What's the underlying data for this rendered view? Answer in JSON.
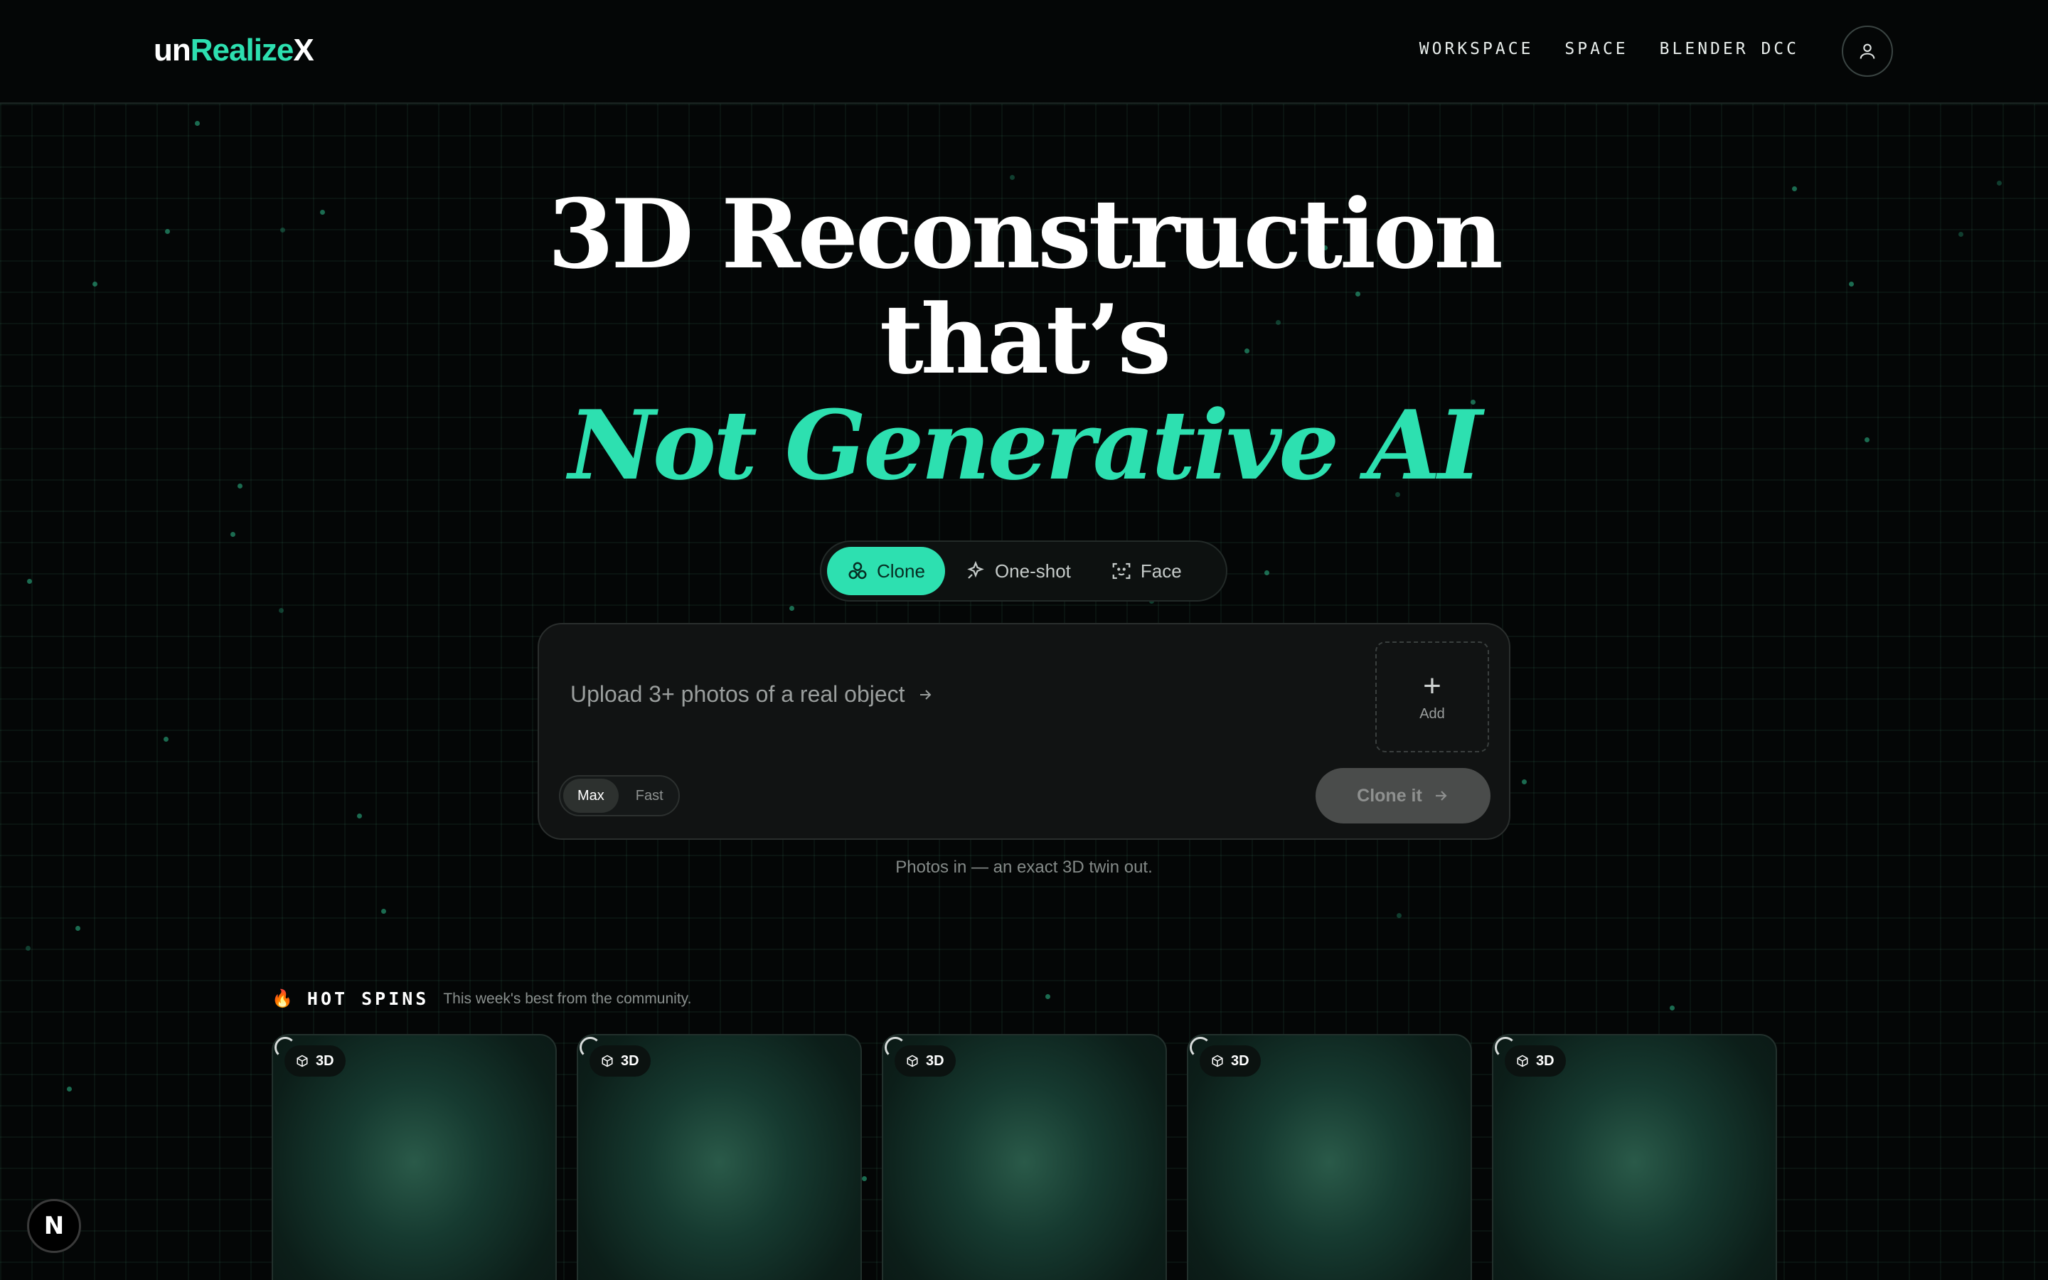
{
  "brand": {
    "part1": "un",
    "part2": "Realize",
    "part3": "X"
  },
  "nav": {
    "workspace": "WORKSPACE",
    "space": "SPACE",
    "blender": "BLENDER DCC"
  },
  "hero": {
    "line1": "3D Reconstruction",
    "line2": "that’s",
    "line3": "Not Generative AI"
  },
  "modes": [
    {
      "label": "Clone",
      "icon": "clone-icon",
      "active": true
    },
    {
      "label": "One-shot",
      "icon": "sparkle-icon",
      "active": false
    },
    {
      "label": "Face",
      "icon": "face-scan-icon",
      "active": false
    }
  ],
  "upload": {
    "prompt": "Upload 3+ photos of a real object",
    "add_label": "Add"
  },
  "quality": {
    "max": "Max",
    "fast": "Fast",
    "selected": "Max"
  },
  "action": {
    "clone_label": "Clone it"
  },
  "tagline": "Photos in — an exact 3D twin out.",
  "hot_spins": {
    "title": "HOT SPINS",
    "subtitle": "This week's best from the community.",
    "cards": [
      {
        "badge": "3D"
      },
      {
        "badge": "3D"
      },
      {
        "badge": "3D"
      },
      {
        "badge": "3D"
      },
      {
        "badge": "3D"
      }
    ]
  },
  "corner_badge": "N",
  "colors": {
    "accent": "#2de0b0",
    "background": "#040606",
    "panel": "#111313"
  }
}
